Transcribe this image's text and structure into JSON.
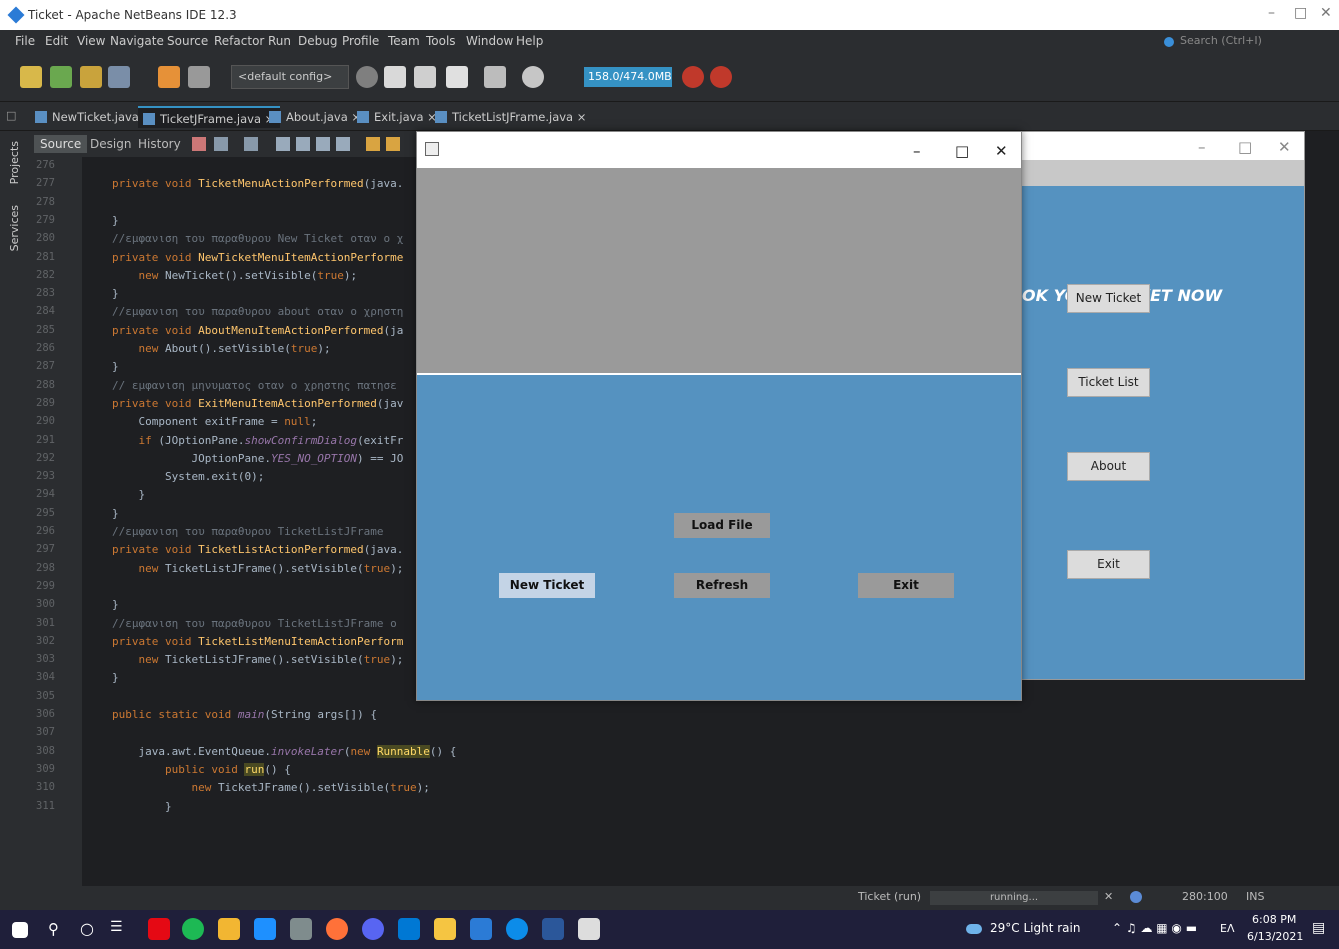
{
  "ide": {
    "title": "Ticket - Apache NetBeans IDE 12.3",
    "menu": [
      "File",
      "Edit",
      "View",
      "Navigate",
      "Source",
      "Refactor",
      "Run",
      "Debug",
      "Profile",
      "Team",
      "Tools",
      "Window",
      "Help"
    ],
    "search_placeholder": "Search (Ctrl+I)",
    "config": "<default config>",
    "memory": "158.0/474.0MB",
    "tabs": [
      "NewTicket.java",
      "TicketJFrame.java",
      "About.java",
      "Exit.java",
      "TicketListJFrame.java"
    ],
    "active_tab": "TicketJFrame.java",
    "editor_modes": [
      "Source",
      "Design",
      "History"
    ],
    "side_tabs": [
      "Projects",
      "Services"
    ]
  },
  "code_lines": [
    {
      "n": "276",
      "t": ""
    },
    {
      "n": "277",
      "t": "private void TicketMenuActionPerformed(java."
    },
    {
      "n": "278",
      "t": ""
    },
    {
      "n": "279",
      "t": "}"
    },
    {
      "n": "280",
      "t": "//εμφανιση του παραθυρου New Ticket οταν ο χ"
    },
    {
      "n": "281",
      "t": "private void NewTicketMenuItemActionPerforme"
    },
    {
      "n": "282",
      "t": "    new NewTicket().setVisible(true);"
    },
    {
      "n": "283",
      "t": "}"
    },
    {
      "n": "284",
      "t": "//εμφανιση του παραθυρου about οταν ο χρηστη"
    },
    {
      "n": "285",
      "t": "private void AboutMenuItemActionPerformed(ja"
    },
    {
      "n": "286",
      "t": "    new About().setVisible(true);"
    },
    {
      "n": "287",
      "t": "}"
    },
    {
      "n": "288",
      "t": "// εμφανιση μηνυματος οταν ο χρηστης πατησε"
    },
    {
      "n": "289",
      "t": "private void ExitMenuItemActionPerformed(jav"
    },
    {
      "n": "290",
      "t": "    Component exitFrame = null;"
    },
    {
      "n": "291",
      "t": "    if (JOptionPane.showConfirmDialog(exitFr"
    },
    {
      "n": "292",
      "t": "            JOptionPane.YES_NO_OPTION) == JO"
    },
    {
      "n": "293",
      "t": "        System.exit(0);"
    },
    {
      "n": "294",
      "t": "    }"
    },
    {
      "n": "295",
      "t": "}"
    },
    {
      "n": "296",
      "t": "//εμφανιση του παραθυρου TicketListJFrame"
    },
    {
      "n": "297",
      "t": "private void TicketListActionPerformed(java."
    },
    {
      "n": "298",
      "t": "    new TicketListJFrame().setVisible(true);"
    },
    {
      "n": "299",
      "t": ""
    },
    {
      "n": "300",
      "t": "}"
    },
    {
      "n": "301",
      "t": "//εμφανιση του παραθυρου TicketListJFrame ο"
    },
    {
      "n": "302",
      "t": "private void TicketListMenuItemActionPerform"
    },
    {
      "n": "303",
      "t": "    new TicketListJFrame().setVisible(true);"
    },
    {
      "n": "304",
      "t": "}"
    },
    {
      "n": "305",
      "t": ""
    },
    {
      "n": "306",
      "t": "public static void main(String args[]) {"
    },
    {
      "n": "307",
      "t": ""
    },
    {
      "n": "308",
      "t": "    java.awt.EventQueue.invokeLater(new Runnable() {"
    },
    {
      "n": "309",
      "t": "        public void run() {"
    },
    {
      "n": "310",
      "t": "            new TicketJFrame().setVisible(true);"
    },
    {
      "n": "311",
      "t": "        }"
    }
  ],
  "back_window": {
    "heading": "OK YOUR TICKET NOW",
    "buttons": [
      "New Ticket",
      "Ticket List",
      "About",
      "Exit"
    ]
  },
  "front_window": {
    "buttons": {
      "load": "Load File",
      "new": "New Ticket",
      "refresh": "Refresh",
      "exit": "Exit"
    }
  },
  "status": {
    "task": "Ticket (run)",
    "progress": "running...",
    "position": "280:100",
    "mode": "INS"
  },
  "taskbar": {
    "weather": "29°C  Light rain",
    "lang": "ΕΛ",
    "time": "6:08 PM",
    "date": "6/13/2021"
  }
}
